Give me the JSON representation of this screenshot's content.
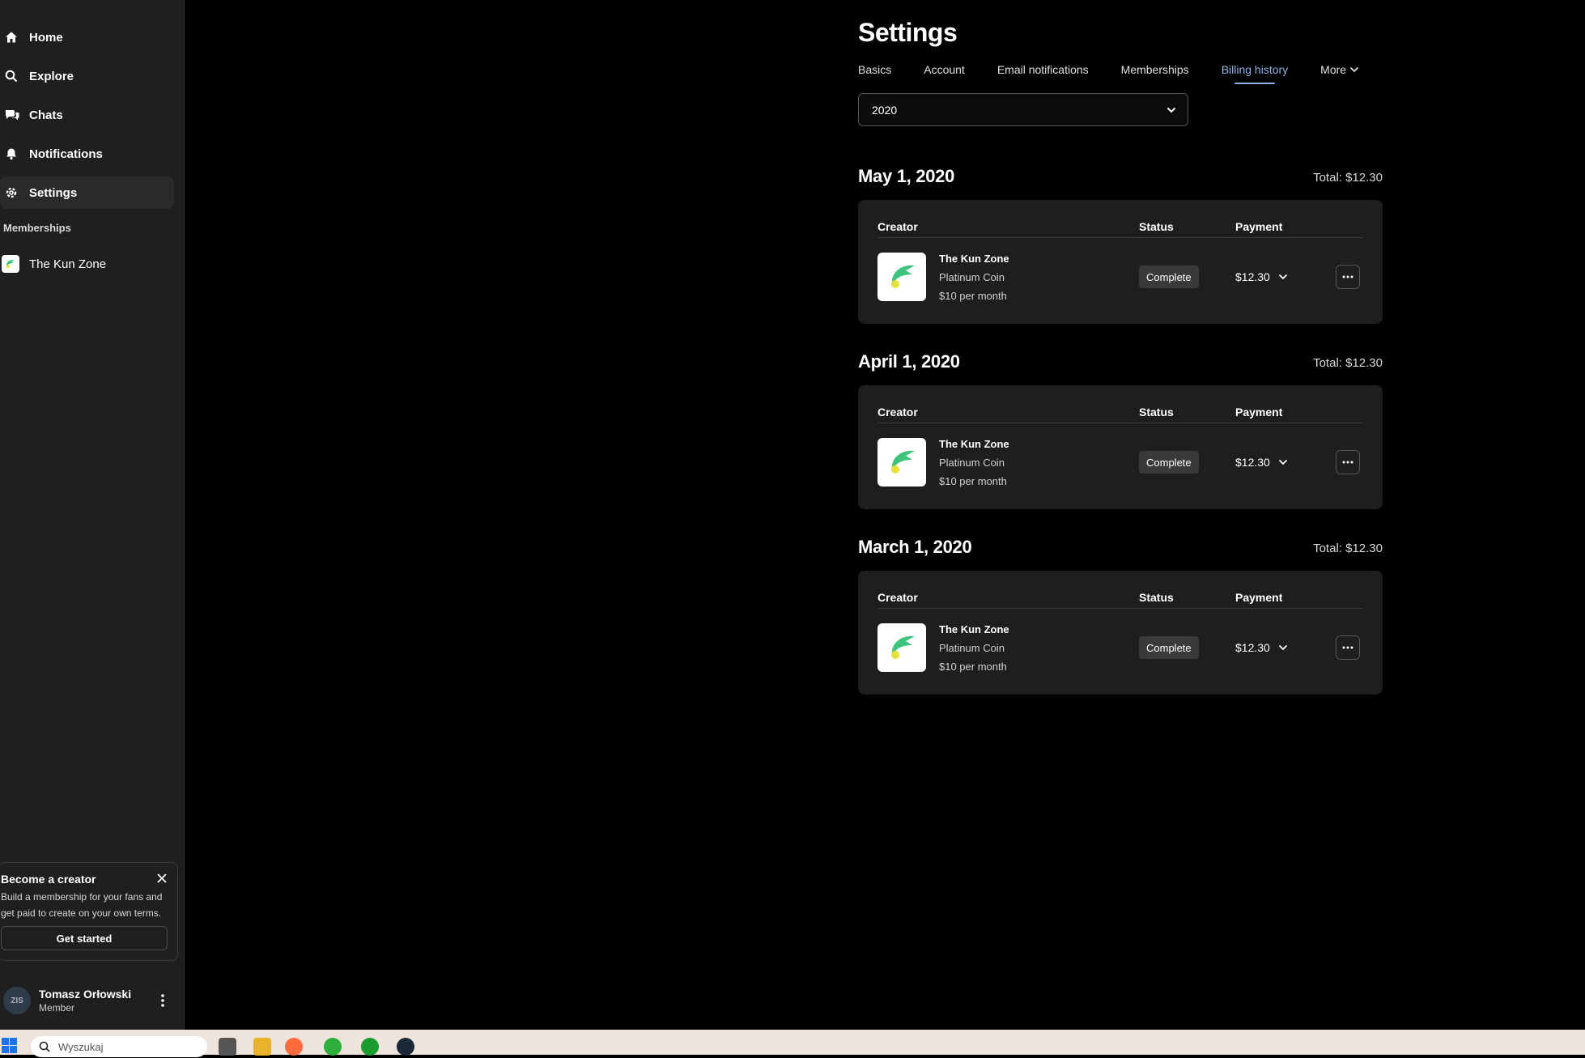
{
  "sidebar": {
    "nav": [
      {
        "label": "Home",
        "icon": "home-icon"
      },
      {
        "label": "Explore",
        "icon": "search-icon"
      },
      {
        "label": "Chats",
        "icon": "chat-icon"
      },
      {
        "label": "Notifications",
        "icon": "bell-icon"
      },
      {
        "label": "Settings",
        "icon": "gear-icon"
      }
    ],
    "memberships_title": "Memberships",
    "memberships": [
      {
        "label": "The Kun Zone"
      }
    ],
    "creator_card": {
      "title": "Become a creator",
      "body": "Build a membership for your fans and get paid to create on your own terms.",
      "cta": "Get started"
    },
    "user": {
      "name": "Tomasz Orłowski",
      "role": "Member",
      "avatar_text": "ZIS"
    }
  },
  "main": {
    "title": "Settings",
    "tabs": [
      "Basics",
      "Account",
      "Email notifications",
      "Memberships",
      "Billing history",
      "More"
    ],
    "active_tab": "Billing history",
    "year": "2020",
    "columns": {
      "creator": "Creator",
      "status": "Status",
      "payment": "Payment"
    },
    "groups": [
      {
        "date": "May 1, 2020",
        "total": "Total: $12.30",
        "row": {
          "creator": "The Kun Zone",
          "tier": "Platinum Coin",
          "price": "$10 per month",
          "status": "Complete",
          "payment": "$12.30"
        }
      },
      {
        "date": "April 1, 2020",
        "total": "Total: $12.30",
        "row": {
          "creator": "The Kun Zone",
          "tier": "Platinum Coin",
          "price": "$10 per month",
          "status": "Complete",
          "payment": "$12.30"
        }
      },
      {
        "date": "March 1, 2020",
        "total": "Total: $12.30",
        "row": {
          "creator": "The Kun Zone",
          "tier": "Platinum Coin",
          "price": "$10 per month",
          "status": "Complete",
          "payment": "$12.30"
        }
      }
    ]
  },
  "taskbar": {
    "search_placeholder": "Wyszukaj"
  },
  "colors": {
    "accent": "#8fb2e6",
    "brand_green": "#3ec47a",
    "sidebar_bg": "#1f1f1f",
    "card_bg": "#1e1e1e"
  }
}
